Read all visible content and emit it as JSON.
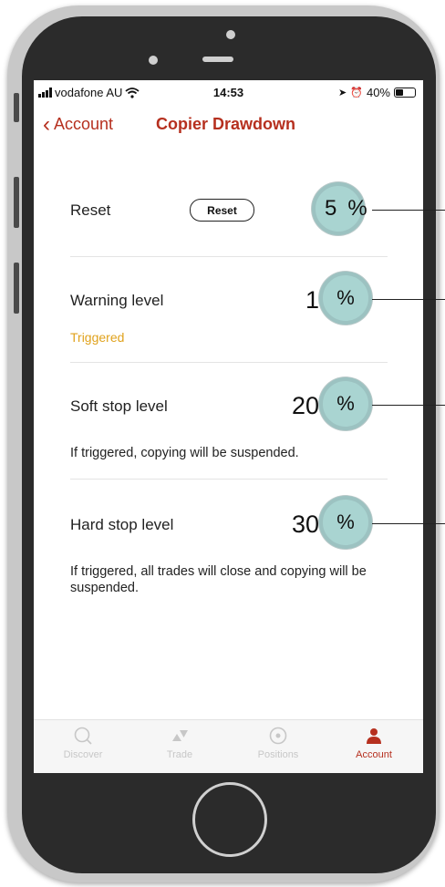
{
  "status_bar": {
    "carrier": "vodafone AU",
    "time": "14:53",
    "battery": "40%",
    "battery_level": 0.4
  },
  "nav": {
    "back_label": "Account",
    "title": "Copier Drawdown"
  },
  "rows": {
    "reset": {
      "label": "Reset",
      "button_label": "Reset",
      "value": "5",
      "unit": "%"
    },
    "warning": {
      "label": "Warning level",
      "status": "Triggered",
      "value": "1",
      "unit": "%"
    },
    "soft_stop": {
      "label": "Soft stop level",
      "value": "20",
      "unit": "%",
      "description": "If triggered, copying will be suspended."
    },
    "hard_stop": {
      "label": "Hard stop level",
      "value": "30",
      "unit": "%",
      "description": "If triggered, all trades will close and copying will be suspended."
    }
  },
  "tabs": [
    {
      "label": "Discover",
      "icon": "search-icon"
    },
    {
      "label": "Trade",
      "icon": "trade-icon"
    },
    {
      "label": "Positions",
      "icon": "positions-icon"
    },
    {
      "label": "Account",
      "icon": "account-icon",
      "active": true
    }
  ],
  "colors": {
    "accent": "#b6301f",
    "warning": "#e0a21c",
    "highlight": "#a9d4d1"
  }
}
